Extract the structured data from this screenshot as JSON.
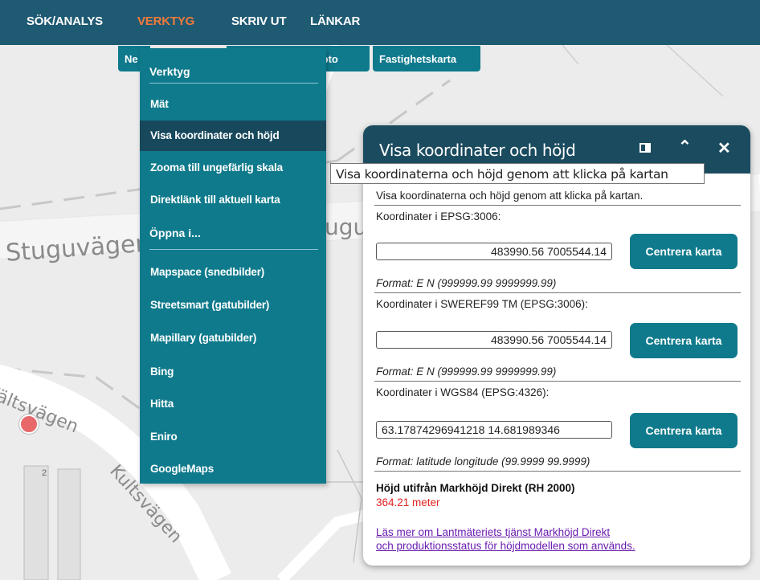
{
  "nav": {
    "items": [
      {
        "label": "SÖK/ANALYS"
      },
      {
        "label": "VERKTYG"
      },
      {
        "label": "SKRIV UT"
      },
      {
        "label": "LÄNKAR"
      }
    ],
    "active_color": "#f07a3a",
    "bar_color": "#1f5a73"
  },
  "basemaps": {
    "partial_left": "Ne",
    "partial_mid": "rtofoto",
    "fastighetskarta": "Fastighetskarta"
  },
  "menu": {
    "heading": "Verktyg",
    "items": [
      {
        "label": "Mät"
      },
      {
        "label": "Visa koordinater och höjd"
      },
      {
        "label": "Zooma till ungefärlig skala"
      },
      {
        "label": "Direktlänk till aktuell karta"
      }
    ],
    "open_heading": "Öppna i...",
    "open_items": [
      {
        "label": "Mapspace (snedbilder)"
      },
      {
        "label": "Streetsmart (gatubilder)"
      },
      {
        "label": "Mapillary (gatubilder)"
      },
      {
        "label": "Bing"
      },
      {
        "label": "Hitta"
      },
      {
        "label": "Eniro"
      },
      {
        "label": "GoogleMaps"
      }
    ],
    "color": "#0f7a8c",
    "hover_color": "#17485c"
  },
  "tooltip": "Visa koordinaterna och höjd genom att klicka på kartan",
  "panel": {
    "title": "Visa koordinater och höjd",
    "intro": "Visa koordinaterna och höjd genom att klicka på kartan.",
    "sections": [
      {
        "label": "Koordinater i EPSG:3006:",
        "value": "483990.56 7005544.14",
        "format": "Format: E N (999999.99 9999999.99)"
      },
      {
        "label": "Koordinater i SWEREF99 TM (EPSG:3006):",
        "value": "483990.56 7005544.14",
        "format": "Format: E N (999999.99 9999999.99)"
      },
      {
        "label": "Koordinater i WGS84 (EPSG:4326):",
        "value": "63.17874296941218 14.681989346",
        "format": "Format: latitude longitude (99.9999 99.9999)"
      }
    ],
    "center_button": "Centrera karta",
    "height_heading": "Höjd utifrån Markhöjd Direkt (RH 2000)",
    "height_value": "364.21 meter",
    "link_line1": "Läs mer om Lantmäteriets tjänst Markhöjd Direkt",
    "link_line2": "och produktionsstatus för höjdmodellen som används.",
    "icons": {
      "dock": "dock-panel-icon",
      "collapse": "chevron-up-icon",
      "close": "close-icon"
    },
    "header_color": "#1b4b5f",
    "height_color": "#e42020",
    "link_color": "#6a1cb0"
  },
  "map": {
    "street1": "Stuguväger",
    "street1b": "ugu",
    "street2": "fältsvägen",
    "street2b": "Kultsvägen",
    "house_number": "2"
  }
}
